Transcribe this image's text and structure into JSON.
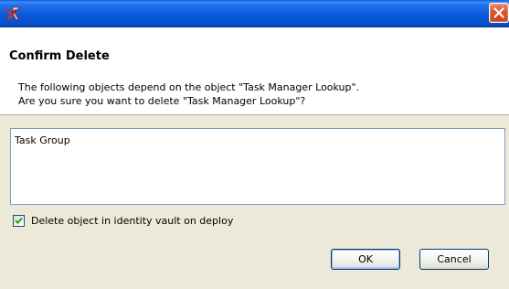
{
  "window": {
    "title": "",
    "titlebar_color": "#0a58d8",
    "close_icon": "close-icon",
    "app_icon": "app-logo-icon"
  },
  "header": {
    "title": "Confirm Delete",
    "message": "The following objects depend on the object \"Task Manager Lookup\".\nAre you sure you want to delete \"Task Manager Lookup\"?"
  },
  "dependents": {
    "items": [
      "Task Group"
    ]
  },
  "options": {
    "delete_in_vault_label": "Delete object in identity vault on deploy",
    "delete_in_vault_checked": true
  },
  "buttons": {
    "ok_label": "OK",
    "cancel_label": "Cancel"
  }
}
